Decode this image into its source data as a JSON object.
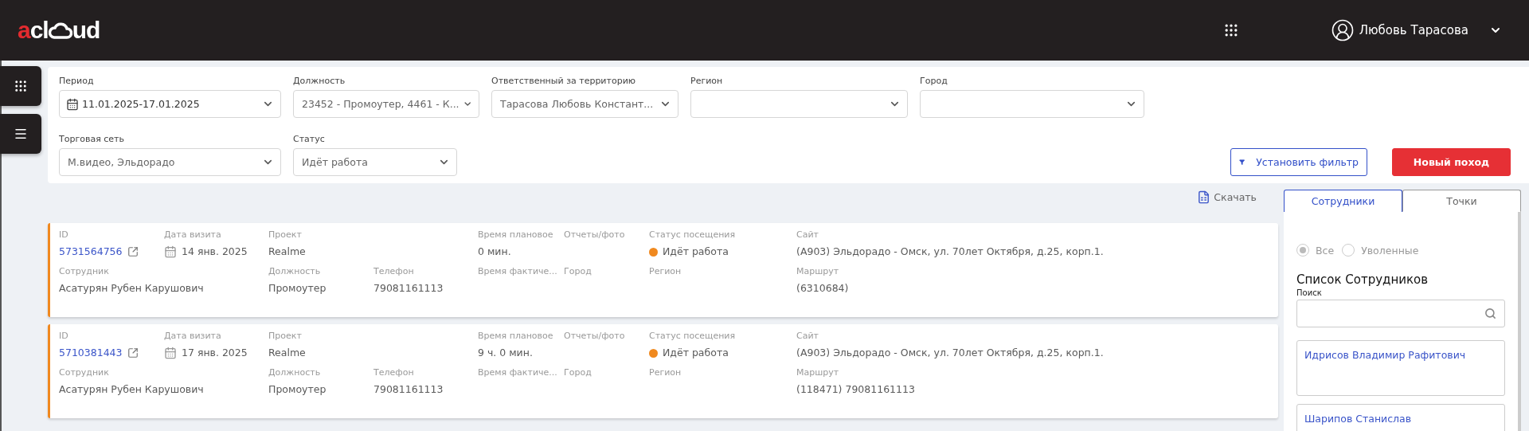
{
  "header": {
    "logo": {
      "accent": "a",
      "before_cloud": "cl",
      "after_cloud": "ud"
    },
    "user": {
      "name": "Любовь Тарасова"
    }
  },
  "filters": {
    "rows": [
      [
        {
          "label": "Период",
          "kind": "date",
          "value": "11.01.2025-17.01.2025"
        },
        {
          "label": "Должность",
          "kind": "select",
          "value": "23452 - Промоутер, 4461 - К..."
        },
        {
          "label": "Ответственный за территорию",
          "kind": "select",
          "value": "Тарасова Любовь Констант..."
        },
        {
          "label": "Регион",
          "kind": "select"
        },
        {
          "label": "Город",
          "kind": "select"
        }
      ],
      [
        {
          "label": "Торговая сеть",
          "kind": "select",
          "value": "М.видео, Эльдорадо"
        },
        {
          "label": "Статус",
          "kind": "select",
          "value": "Идёт работа"
        }
      ]
    ],
    "buttons": [
      {
        "label": "Установить фильтр",
        "kind": "outline"
      },
      {
        "label": "Новый поход",
        "kind": "primary"
      }
    ]
  },
  "download": {
    "label": "Скачать"
  },
  "visits": [
    {
      "rows": [
        [
          {
            "label": "ID",
            "kind": "link",
            "value": "5731564756"
          },
          {
            "label": "Дата визита",
            "kind": "date",
            "value": "14 янв. 2025"
          },
          {
            "label": "Проект",
            "kind": "text",
            "value": "Realme"
          },
          "",
          {
            "label": "Время плановое",
            "kind": "text",
            "value": "0 мин."
          },
          {
            "label": "Отчеты/фото",
            "kind": "text"
          },
          {
            "label": "Статус посещения",
            "kind": "status",
            "value": "Идёт работа",
            "color": "#f0891f"
          },
          {
            "label": "Сайт",
            "kind": "text",
            "value": "(A903) Эльдорадо - Омск, ул. 70лет Октября, д.25, корп.1."
          }
        ],
        [
          {
            "label": "Сотрудник",
            "kind": "text",
            "value": "Асатурян Рубен Карушович"
          },
          "",
          {
            "label": "Должность",
            "kind": "text",
            "value": "Промоутер"
          },
          {
            "label": "Телефон",
            "kind": "text",
            "value": "79081161113"
          },
          {
            "label": "Время фактиче...",
            "kind": "text"
          },
          {
            "label": "Город",
            "kind": "text"
          },
          {
            "label": "Регион",
            "kind": "text"
          },
          {
            "label": "Маршрут",
            "kind": "text",
            "value": "(6310684)"
          }
        ]
      ]
    },
    {
      "rows": [
        [
          {
            "label": "ID",
            "kind": "link",
            "value": "5710381443"
          },
          {
            "label": "Дата визита",
            "kind": "date",
            "value": "17 янв. 2025"
          },
          {
            "label": "Проект",
            "kind": "text",
            "value": "Realme"
          },
          "",
          {
            "label": "Время плановое",
            "kind": "text",
            "value": "9 ч. 0 мин."
          },
          {
            "label": "Отчеты/фото",
            "kind": "text"
          },
          {
            "label": "Статус посещения",
            "kind": "status",
            "value": "Идёт работа",
            "color": "#f0891f"
          },
          {
            "label": "Сайт",
            "kind": "text",
            "value": "(A903) Эльдорадо - Омск, ул. 70лет Октября, д.25, корп.1."
          }
        ],
        [
          {
            "label": "Сотрудник",
            "kind": "text",
            "value": "Асатурян Рубен Карушович"
          },
          "",
          {
            "label": "Должность",
            "kind": "text",
            "value": "Промоутер"
          },
          {
            "label": "Телефон",
            "kind": "text",
            "value": "79081161113"
          },
          {
            "label": "Время фактиче...",
            "kind": "text"
          },
          {
            "label": "Город",
            "kind": "text"
          },
          {
            "label": "Регион",
            "kind": "text"
          },
          {
            "label": "Маршрут",
            "kind": "text",
            "value": "(118471) 79081161113"
          }
        ]
      ]
    }
  ],
  "side_panel": {
    "tabs": [
      {
        "label": "Сотрудники",
        "selected": true
      },
      {
        "label": "Точки",
        "selected": false
      }
    ],
    "radios": [
      {
        "label": "Все",
        "selected": true
      },
      {
        "label": "Уволенные",
        "selected": false
      }
    ],
    "list_title": "Список Сотрудников",
    "search_label": "Поиск",
    "employees": [
      {
        "name": "Идрисов Владимир Рафитович"
      },
      {
        "name": "Шарипов Станислав"
      }
    ]
  }
}
